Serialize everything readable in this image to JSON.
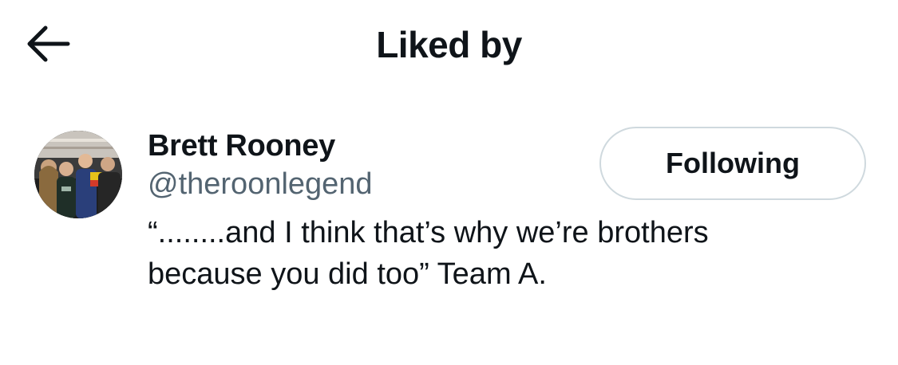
{
  "header": {
    "title": "Liked by",
    "back_icon": "arrow-left-icon"
  },
  "user": {
    "name": "Brett Rooney",
    "handle": "@theroonlegend",
    "bio": "“........and I think that’s why we’re brothers because you did too” Team A.",
    "follow_label": "Following",
    "avatar": "group-photo-avatar"
  },
  "colors": {
    "text_primary": "#0f1419",
    "text_secondary": "#536471",
    "button_border": "#cfd9de",
    "background": "#ffffff"
  }
}
